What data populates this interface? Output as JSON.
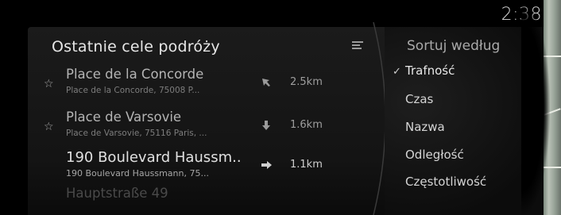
{
  "clock": "2:38",
  "recent": {
    "title": "Ostatnie cele podróży",
    "items": [
      {
        "name": "Place de la Concorde",
        "address": "Place de la Concorde, 75008 P...",
        "distance": "2.5km",
        "direction": "northwest"
      },
      {
        "name": "Place de Varsovie",
        "address": "Place de Varsovie, 75116 Paris, ...",
        "distance": "1.6km",
        "direction": "south"
      },
      {
        "name": "190 Boulevard Haussm...",
        "address": "190 Boulevard Haussmann, 75...",
        "distance": "1.1km",
        "direction": "east"
      },
      {
        "name": "Hauptstraße 49",
        "address": "",
        "distance": ""
      }
    ]
  },
  "sort": {
    "title": "Sortuj według",
    "options": [
      "Trafność",
      "Czas",
      "Nazwa",
      "Odległość",
      "Częstotliwość"
    ],
    "selected": "Trafność"
  },
  "icons": {
    "star": "star-icon",
    "filter": "filter-icon",
    "check": "checkmark-icon"
  }
}
